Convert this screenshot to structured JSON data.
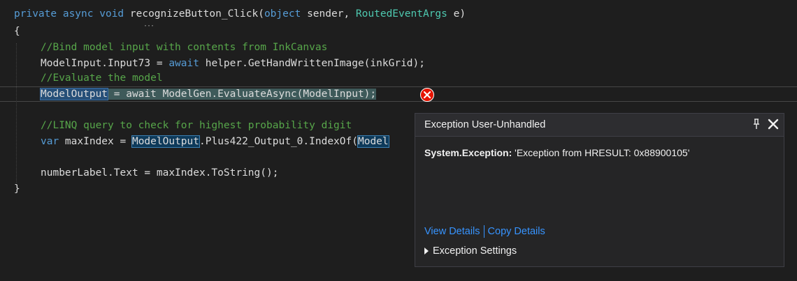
{
  "code": {
    "line1": {
      "kw1": "private",
      "kw2": "async",
      "kw3": "void",
      "method": "recognizeButton_Click",
      "open": "(",
      "kw4": "object",
      "p1": " sender, ",
      "type1": "RoutedEventArgs",
      "p2": " e)"
    },
    "line2": "{",
    "line3": "//Bind model input with contents from InkCanvas",
    "line4": {
      "a": "ModelInput.Input73 = ",
      "kw": "await",
      "b": " helper.GetHandWrittenImage(inkGrid);"
    },
    "line5": "//Evaluate the model",
    "line6": {
      "sel": "ModelOutput",
      "rest": " = await ModelGen.EvaluateAsync(ModelInput);"
    },
    "line7": "//LINQ query to check for highest probability digit",
    "line8": {
      "kw": "var",
      "a": " maxIndex = ",
      "sel": "ModelOutput",
      "b": ".Plus422_Output_0.IndexOf(",
      "sel2": "Model"
    },
    "line9": "numberLabel.Text = maxIndex.ToString();",
    "line10": "}"
  },
  "exception_popup": {
    "title": "Exception User-Unhandled",
    "exception_type": "System.Exception:",
    "message": "'Exception from HRESULT: 0x88900105'",
    "view_details": "View Details",
    "copy_details": "Copy Details",
    "settings": "Exception Settings"
  },
  "colors": {
    "background": "#1e1e1e",
    "keyword": "#569cd6",
    "type": "#4ec9b0",
    "comment": "#57a64a",
    "link": "#3794ff",
    "error": "#e51400"
  }
}
